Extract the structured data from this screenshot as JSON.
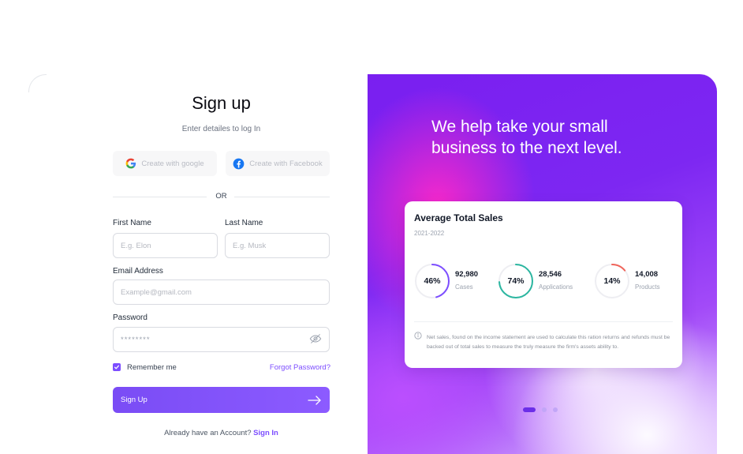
{
  "form": {
    "title": "Sign up",
    "subtitle": "Enter detailes to log In",
    "google_label": "Create with google",
    "facebook_label": "Create with Facebook",
    "or_label": "OR",
    "first_name_label": "First Name",
    "first_name_placeholder": "E.g. Elon",
    "last_name_label": "Last Name",
    "last_name_placeholder": "E.g. Musk",
    "email_label": "Email Address",
    "email_placeholder": "Example@gmail.com",
    "password_label": "Password",
    "password_value": "********",
    "remember_label": "Remember me",
    "forgot_label": "Forgot Password?",
    "submit_label": "Sign Up",
    "footer_text": "Already have an Account?",
    "footer_link": "Sign In"
  },
  "hero": {
    "headline_line1": "We help take your small",
    "headline_line2": "business to the next level.",
    "card": {
      "title": "Average Total Sales",
      "period": "2021-2022",
      "metrics": [
        {
          "percent": "46%",
          "value": "92,980",
          "label": "Cases",
          "fraction": 0.46,
          "color": "#7c4dff"
        },
        {
          "percent": "74%",
          "value": "28,546",
          "label": "Applications",
          "fraction": 0.74,
          "color": "#2bb6a0"
        },
        {
          "percent": "14%",
          "value": "14,008",
          "label": "Products",
          "fraction": 0.14,
          "color": "#f0645a"
        }
      ],
      "note": "Net sales, found on the income statement are used to calculate this ration returns and refunds must be backed out of total sales to measure the truly measure the firm's assets ability to."
    },
    "carousel": {
      "count": 3,
      "active": 0
    }
  },
  "colors": {
    "accent": "#7c4dff",
    "hero_purple": "#7a1ff0",
    "hero_pink": "#ff28c8"
  },
  "icons": {
    "google": "google-icon",
    "facebook": "facebook-icon",
    "eye": "eye-off-icon",
    "arrow": "arrow-right-icon",
    "info": "info-icon"
  }
}
